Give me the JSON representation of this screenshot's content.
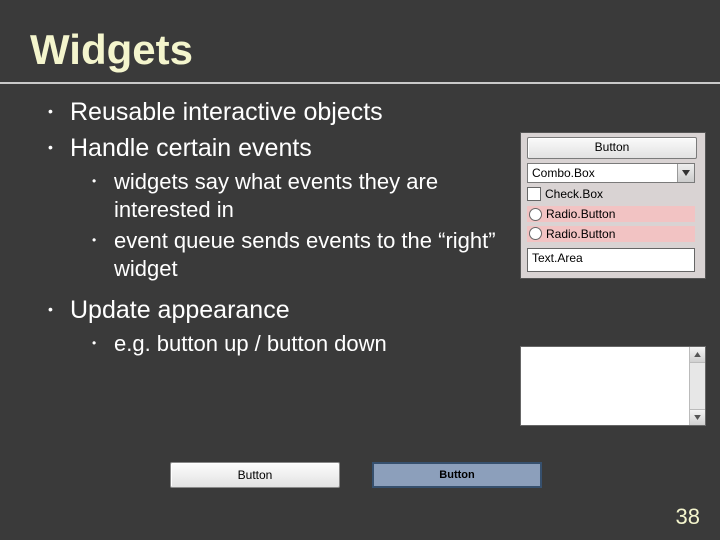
{
  "title": "Widgets",
  "bullets": {
    "b1": "Reusable interactive objects",
    "b2": "Handle certain events",
    "b2a": "widgets say what events they are interested in",
    "b2b": "event queue sends events to the “right” widget",
    "b3": "Update appearance",
    "b3a": "e.g. button up / button down"
  },
  "showcase": {
    "button": "Button",
    "combo": "Combo.Box",
    "checkbox": "Check.Box",
    "radio1": "Radio.Button",
    "radio2": "Radio.Button",
    "textarea": "Text.Area"
  },
  "bottom": {
    "up_label": "Button",
    "down_label": "Button"
  },
  "page_number": "38"
}
